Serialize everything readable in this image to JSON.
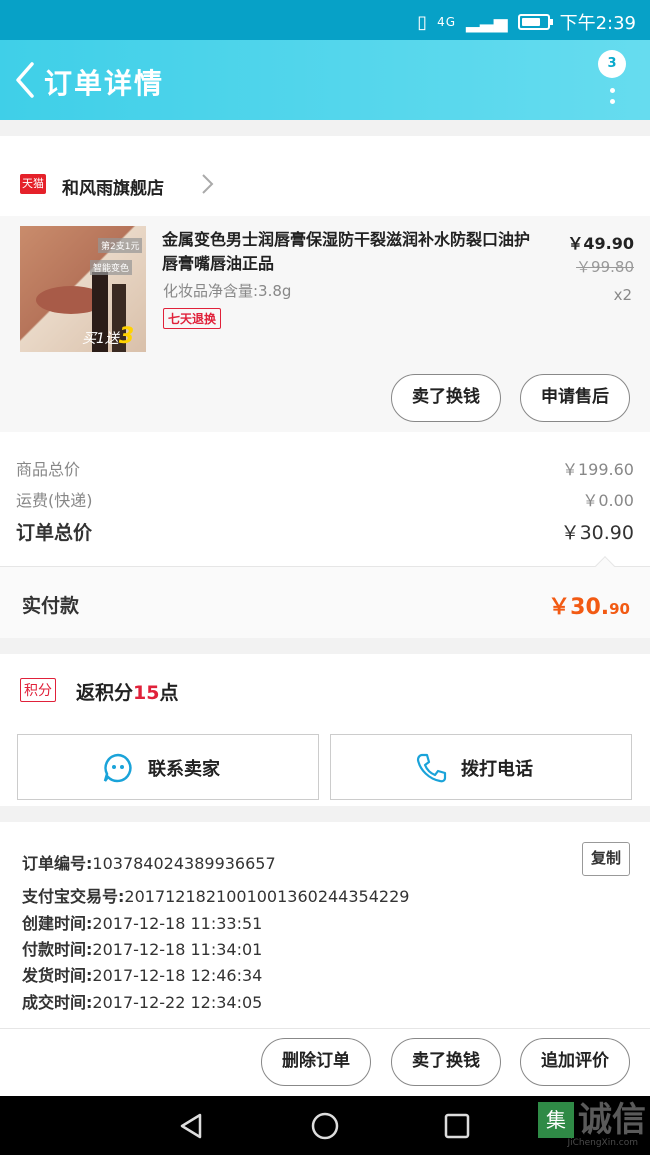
{
  "status_bar": {
    "network": "4G",
    "time": "下午2:39"
  },
  "header": {
    "title": "订单详情",
    "badge_count": "3"
  },
  "shop": {
    "logo_text": "天猫",
    "name": "和风雨旗舰店"
  },
  "product": {
    "title": "金属变色男士润唇膏保湿防干裂滋润补水防裂口油护唇膏嘴唇油正品",
    "spec": "化妆品净含量:3.8g",
    "badge": "七天退换",
    "price": "￥49.90",
    "original_price": "￥99.80",
    "quantity": "x2",
    "image_tags": [
      "第2支1元",
      "智能变色"
    ],
    "image_promo_text": "买1送",
    "image_promo_num": "3",
    "buttons": {
      "sold_for_cash": "卖了换钱",
      "after_sale": "申请售后"
    }
  },
  "totals": {
    "goods_label": "商品总价",
    "goods_value": "￥199.60",
    "shipping_label": "运费(快递)",
    "shipping_value": "￥0.00",
    "order_label": "订单总价",
    "order_value": "￥30.90"
  },
  "paid": {
    "label": "实付款",
    "int": "￥30.",
    "dec": "90"
  },
  "points": {
    "tag": "积分",
    "prefix": "返积分",
    "num": "15",
    "suffix": "点"
  },
  "actions": {
    "contact_seller": "联系卖家",
    "call": "拨打电话"
  },
  "order_info": {
    "copy_label": "复制",
    "order_no_key": "订单编号:",
    "order_no": "103784024389936657",
    "alipay_key": "支付宝交易号:",
    "alipay_no": "2017121821001001360244354229",
    "created_key": "创建时间:",
    "created": "2017-12-18 11:33:51",
    "paid_key": "付款时间:",
    "paid": "2017-12-18 11:34:01",
    "shipped_key": "发货时间:",
    "shipped": "2017-12-18 12:46:34",
    "done_key": "成交时间:",
    "done": "2017-12-22 12:34:05"
  },
  "bottom_buttons": {
    "delete": "删除订单",
    "sell": "卖了换钱",
    "review": "追加评价"
  },
  "watermark": {
    "logo": "集",
    "text": "诚信",
    "sub": "JiChengXin.com"
  },
  "colors": {
    "header_start": "#3fcfe8",
    "header_end": "#66dcef",
    "accent_red": "#e0213a",
    "price_orange": "#f25a13"
  },
  "battery_level": 0.75
}
